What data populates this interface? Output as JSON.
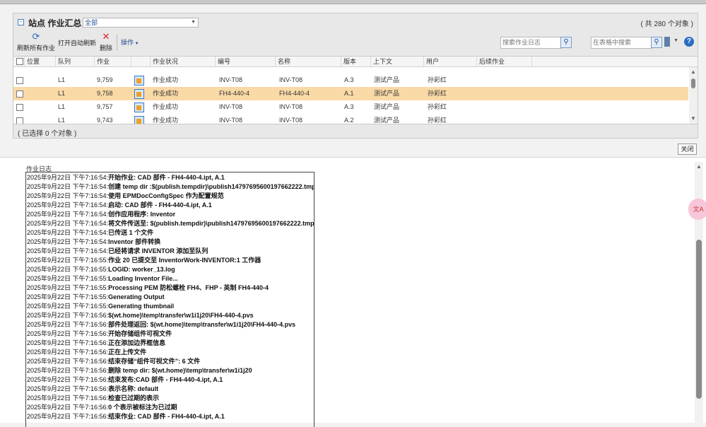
{
  "panel": {
    "title": "站点 作业汇总",
    "view_select": "全部",
    "object_count": "( 共 280 个对象 )",
    "selected_count": "( 已选择 0 个对象 )"
  },
  "toolbar": {
    "refresh_all": "刷新所有作业",
    "auto_refresh": "打开自动刷新",
    "delete": "删除",
    "operations": "操作",
    "search_log_placeholder": "搜索作业日志",
    "search_table_placeholder": "在表格中搜索"
  },
  "table": {
    "columns": [
      "位置",
      "队列",
      "作业",
      "",
      "作业状况",
      "编号",
      "名称",
      "版本",
      "上下文",
      "用户",
      "后续作业"
    ],
    "rows": [
      {
        "queue": "L1",
        "job": "9,759",
        "status": "作业成功",
        "number": "INV-T08",
        "name": "INV-T08",
        "version": "A.3",
        "context": "测试产品",
        "user": "孙彩红",
        "selected": false
      },
      {
        "queue": "L1",
        "job": "9,758",
        "status": "作业成功",
        "number": "FH4-440-4",
        "name": "FH4-440-4",
        "version": "A.1",
        "context": "测试产品",
        "user": "孙彩红",
        "selected": true
      },
      {
        "queue": "L1",
        "job": "9,757",
        "status": "作业成功",
        "number": "INV-T08",
        "name": "INV-T08",
        "version": "A.3",
        "context": "测试产品",
        "user": "孙彩红",
        "selected": false
      },
      {
        "queue": "L1",
        "job": "9,743",
        "status": "作业成功",
        "number": "INV-T08",
        "name": "INV-T08",
        "version": "A.2",
        "context": "测试产品",
        "user": "孙彩红",
        "selected": false
      }
    ]
  },
  "close_label": "关闭",
  "log": {
    "title": "作业日志",
    "lines": [
      {
        "ts": "2025年9月22日 下午7:16:54:",
        "msg": "开始作业: CAD 部件  - FH4-440-4.ipt, A.1"
      },
      {
        "ts": "2025年9月22日 下午7:16:54:",
        "msg": "创建 temp dir :$(publish.tempdir)\\publish14797695600197662222.tmp"
      },
      {
        "ts": "2025年9月22日 下午7:16:54:",
        "msg": "使用 EPMDocConfigSpec 作为配置规范"
      },
      {
        "ts": "2025年9月22日 下午7:16:54:",
        "msg": "启动: CAD 部件  - FH4-440-4.ipt, A.1"
      },
      {
        "ts": "2025年9月22日 下午7:16:54:",
        "msg": "创作应用程序: Inventor"
      },
      {
        "ts": "2025年9月22日 下午7:16:54:",
        "msg": "将文件传送至: $(publish.tempdir)\\publish14797695600197662222.tmp"
      },
      {
        "ts": "2025年9月22日 下午7:16:54:",
        "msg": "已传送 1 个文件"
      },
      {
        "ts": "2025年9月22日 下午7:16:54:",
        "msg": "Inventor 部件转换"
      },
      {
        "ts": "2025年9月22日 下午7:16:54:",
        "msg": "已经将请求 INVENTOR 添加至队列"
      },
      {
        "ts": "2025年9月22日 下午7:16:55:",
        "msg": "作业 20 已提交至 InventorWork-INVENTOR:1 工作器"
      },
      {
        "ts": "2025年9月22日 下午7:16:55:",
        "msg": "LOGID: worker_13.log"
      },
      {
        "ts": "2025年9月22日 下午7:16:55:",
        "msg": "Loading Inventor File..."
      },
      {
        "ts": "2025年9月22日 下午7:16:55:",
        "msg": "Processing PEM 防松螺栓 FH4、FHP - 英制 FH4-440-4"
      },
      {
        "ts": "2025年9月22日 下午7:16:55:",
        "msg": "Generating Output"
      },
      {
        "ts": "2025年9月22日 下午7:16:55:",
        "msg": "Generating thumbnail"
      },
      {
        "ts": "2025年9月22日 下午7:16:56:",
        "msg": "$(wt.home)\\temp\\transfer\\w1i1j20\\FH4-440-4.pvs"
      },
      {
        "ts": "2025年9月22日 下午7:16:56:",
        "msg": "部件处理返回: $(wt.home)\\temp\\transfer\\w1i1j20\\FH4-440-4.pvs"
      },
      {
        "ts": "2025年9月22日 下午7:16:56:",
        "msg": "开始存储组件可视文件"
      },
      {
        "ts": "2025年9月22日 下午7:16:56:",
        "msg": "正在添加边界框信息"
      },
      {
        "ts": "2025年9月22日 下午7:16:56:",
        "msg": "正在上传文件"
      },
      {
        "ts": "2025年9月22日 下午7:16:56:",
        "msg": "结束存储“组件可视文件”: 6 文件"
      },
      {
        "ts": "2025年9月22日 下午7:16:56:",
        "msg": "删除 temp dir: $(wt.home)\\temp\\transfer\\w1i1j20"
      },
      {
        "ts": "2025年9月22日 下午7:16:56:",
        "msg": "结束发布:CAD 部件  - FH4-440-4.ipt, A.1"
      },
      {
        "ts": "2025年9月22日 下午7:16:56:",
        "msg": "表示名称: default"
      },
      {
        "ts": "2025年9月22日 下午7:16:56:",
        "msg": "检查已过期的表示"
      },
      {
        "ts": "2025年9月22日 下午7:16:56:",
        "msg": "0 个表示被标注为已过期"
      },
      {
        "ts": "2025年9月22日 下午7:16:56:",
        "msg": "结束作业: CAD 部件  - FH4-440-4.ipt, A.1"
      }
    ]
  },
  "colors": {
    "selected_row": "#f9d9a6",
    "link": "#1f4e94",
    "help": "#2c6cc0"
  }
}
